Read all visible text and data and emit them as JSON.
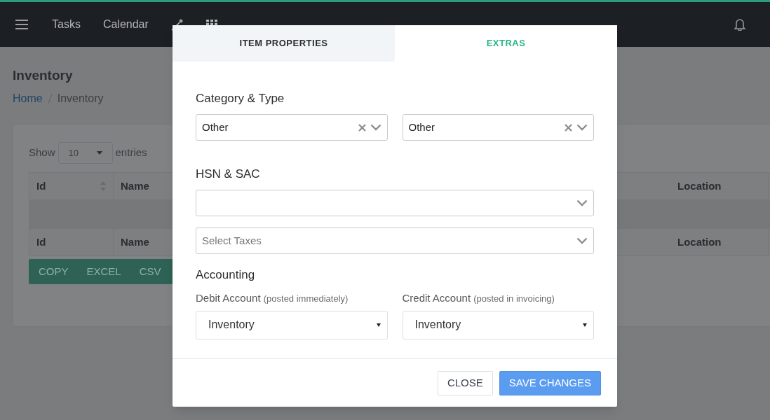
{
  "navbar": {
    "items": [
      {
        "label": "Tasks",
        "kind": "link"
      },
      {
        "label": "Calendar",
        "kind": "link"
      },
      {
        "kind": "wand"
      },
      {
        "kind": "grid"
      }
    ]
  },
  "page": {
    "title": "Inventory",
    "breadcrumb": [
      "Home",
      "Inventory"
    ]
  },
  "table_controls": {
    "show_label": "Show",
    "page_size": "10",
    "entries_label": "entries"
  },
  "table": {
    "header": [
      {
        "label": "Id",
        "sortable": true
      },
      {
        "label": "Name"
      },
      {
        "label": "Location"
      }
    ],
    "footer": [
      "Id",
      "Name",
      "Location"
    ]
  },
  "export_buttons": [
    "COPY",
    "EXCEL",
    "CSV"
  ],
  "modal": {
    "tabs": [
      {
        "label": "ITEM PROPERTIES",
        "selected": false
      },
      {
        "label": "EXTRAS",
        "selected": true
      }
    ],
    "sections": [
      {
        "heading": "Category & Type",
        "fields": [
          {
            "kind": "combo",
            "value": "Other",
            "clearable": true
          },
          {
            "kind": "combo",
            "value": "Other",
            "clearable": true
          }
        ]
      },
      {
        "heading": "HSN & SAC",
        "fields": [
          {
            "kind": "combo",
            "clearable": false
          }
        ]
      },
      {
        "fields": [
          {
            "kind": "combo",
            "placeholder": "Select Taxes",
            "clearable": false
          }
        ]
      },
      {
        "heading": "Accounting",
        "fields": [
          {
            "kind": "select",
            "label": "Debit Account",
            "hint": "(posted immediately)",
            "value": "Inventory"
          },
          {
            "kind": "select",
            "label": "Credit Account",
            "hint": "(posted in invoicing)",
            "value": "Inventory"
          }
        ]
      }
    ],
    "buttons": [
      {
        "label": "CLOSE",
        "kind": "secondary"
      },
      {
        "label": "SAVE CHANGES",
        "kind": "primary"
      }
    ]
  }
}
